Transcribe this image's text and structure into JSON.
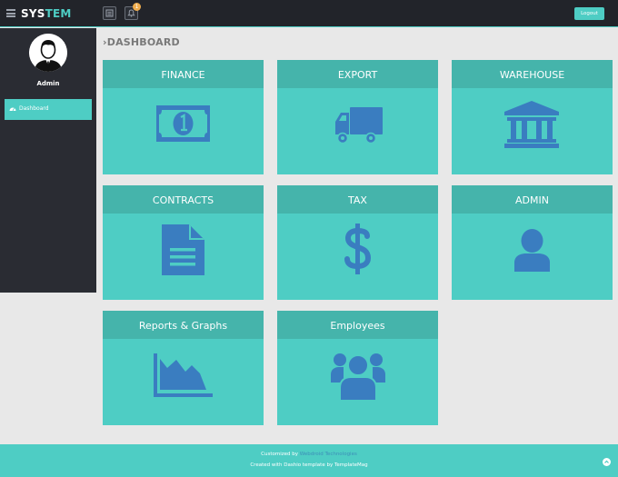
{
  "header": {
    "logo_part1": "SYS",
    "logo_part2": "TEM",
    "notification_count": "1",
    "logout_label": "Logout"
  },
  "sidebar": {
    "user_name": "Admin",
    "items": [
      {
        "label": "Dashboard",
        "icon": "dashboard-icon"
      }
    ]
  },
  "main": {
    "title": "DASHBOARD",
    "tiles": [
      {
        "label": "FINANCE",
        "icon": "banknote-icon"
      },
      {
        "label": "EXPORT",
        "icon": "truck-icon"
      },
      {
        "label": "WAREHOUSE",
        "icon": "bank-building-icon"
      },
      {
        "label": "CONTRACTS",
        "icon": "document-icon"
      },
      {
        "label": "TAX",
        "icon": "dollar-icon"
      },
      {
        "label": "ADMIN",
        "icon": "user-icon"
      },
      {
        "label": "Reports & Graphs",
        "icon": "area-chart-icon"
      },
      {
        "label": "Employees",
        "icon": "users-icon"
      }
    ]
  },
  "footer": {
    "line1_prefix": "Customized by ",
    "line1_link": "Webdroid Technologies",
    "line2": "Created with Dashio template by TemplateMag"
  },
  "colors": {
    "accent": "#4ecdc4",
    "tile_header": "#45b4ab",
    "icon_blue": "#3a7dc0",
    "topbar": "#22242a",
    "sidebar": "#2a2c33"
  }
}
